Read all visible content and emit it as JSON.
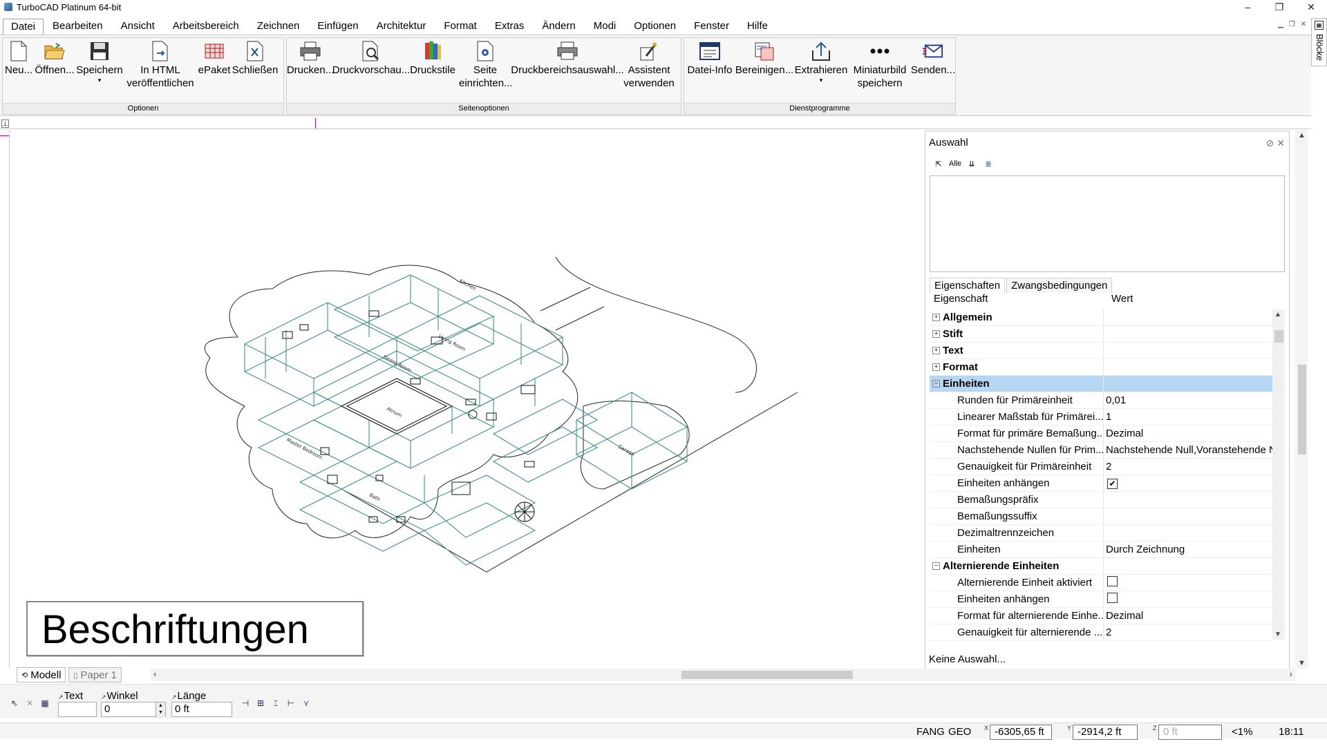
{
  "app": {
    "title": "TurboCAD  Platinum 64-bit",
    "window_controls": [
      "–",
      "❐",
      "✕"
    ]
  },
  "menu": {
    "items": [
      "Datei",
      "Bearbeiten",
      "Ansicht",
      "Arbeitsbereich",
      "Zeichnen",
      "Einfügen",
      "Architektur",
      "Format",
      "Extras",
      "Ändern",
      "Modi",
      "Optionen",
      "Fenster",
      "Hilfe"
    ],
    "active": "Datei"
  },
  "ribbon": {
    "groups": [
      {
        "label": "Optionen",
        "buttons": [
          {
            "label": "Neu...",
            "icon": "new-file-icon"
          },
          {
            "label": "Öffnen...",
            "icon": "open-folder-icon"
          },
          {
            "label": "Speichern",
            "icon": "save-icon",
            "dropdown": true
          },
          {
            "label": "In HTML veröffentlichen",
            "icon": "html-publish-icon"
          },
          {
            "label": "ePaket",
            "icon": "epackage-icon"
          },
          {
            "label": "Schließen",
            "icon": "close-document-icon"
          }
        ]
      },
      {
        "label": "Seitenoptionen",
        "buttons": [
          {
            "label": "Drucken...",
            "icon": "printer-icon"
          },
          {
            "label": "Druckvorschau...",
            "icon": "print-preview-icon"
          },
          {
            "label": "Druckstile",
            "icon": "print-styles-icon"
          },
          {
            "label": "Seite einrichten...",
            "icon": "page-setup-icon"
          },
          {
            "label": "Druckbereichsauswahl...",
            "icon": "print-area-icon"
          },
          {
            "label": "Assistent verwenden",
            "icon": "wizard-icon"
          }
        ]
      },
      {
        "label": "Dienstprogramme",
        "buttons": [
          {
            "label": "Datei-Info",
            "icon": "file-info-icon"
          },
          {
            "label": "Bereinigen...",
            "icon": "cleanup-icon"
          },
          {
            "label": "Extrahieren",
            "icon": "extract-icon",
            "dropdown": true
          },
          {
            "label": "Miniaturbild speichern",
            "icon": "thumbnail-icon"
          },
          {
            "label": "Senden...",
            "icon": "send-mail-icon"
          }
        ]
      }
    ]
  },
  "side_strip": {
    "label": "Blöcke"
  },
  "drawing": {
    "text_box": "Beschriftungen",
    "room_labels": [
      "Living Room",
      "Atrium",
      "Garage",
      "Kitchen",
      "Master Bedroom",
      "Dining Room",
      "Bath"
    ]
  },
  "selector_panel": {
    "title": "Auswahl",
    "tool_icons": [
      "select-tool-icon",
      "Alle",
      "filter-icon",
      "layers-icon"
    ],
    "tabs": [
      "Eigenschaften",
      "Zwangsbedingungen"
    ],
    "active_tab": "Eigenschaften",
    "columns": [
      "Eigenschaft",
      "Wert"
    ],
    "rows": [
      {
        "type": "category",
        "label": "Allgemein",
        "expanded": false,
        "value": ""
      },
      {
        "type": "category",
        "label": "Stift",
        "expanded": false,
        "value": ""
      },
      {
        "type": "category",
        "label": "Text",
        "expanded": false,
        "value": ""
      },
      {
        "type": "category",
        "label": "Format",
        "expanded": false,
        "value": ""
      },
      {
        "type": "category",
        "label": "Einheiten",
        "expanded": true,
        "selected": true,
        "value": ""
      },
      {
        "type": "prop",
        "label": "Runden für Primäreinheit",
        "value": "0,01"
      },
      {
        "type": "prop",
        "label": "Linearer Maßstab für Primärei...",
        "value": "1"
      },
      {
        "type": "prop",
        "label": "Format für primäre Bemaßung...",
        "value": "Dezimal"
      },
      {
        "type": "prop",
        "label": "Nachstehende Nullen für Prim...",
        "value": "Nachstehende Null,Voranstehende N"
      },
      {
        "type": "prop",
        "label": "Genauigkeit für Primäreinheit",
        "value": "2"
      },
      {
        "type": "prop",
        "label": "Einheiten anhängen",
        "value": "",
        "checkbox": true,
        "checked": true
      },
      {
        "type": "prop",
        "label": "Bemaßungspräfix",
        "value": ""
      },
      {
        "type": "prop",
        "label": "Bemaßungssuffix",
        "value": ""
      },
      {
        "type": "prop",
        "label": "Dezimaltrennzeichen",
        "value": ""
      },
      {
        "type": "prop",
        "label": "Einheiten",
        "value": "Durch Zeichnung"
      },
      {
        "type": "category",
        "label": "Alternierende Einheiten",
        "expanded": true,
        "value": ""
      },
      {
        "type": "prop",
        "label": "Alternierende Einheit aktiviert",
        "value": "",
        "checkbox": true,
        "checked": false
      },
      {
        "type": "prop",
        "label": "Einheiten anhängen",
        "value": "",
        "checkbox": true,
        "checked": false
      },
      {
        "type": "prop",
        "label": "Format für alternierende Einhe...",
        "value": "Dezimal"
      },
      {
        "type": "prop",
        "label": "Genauigkeit für alternierende ...",
        "value": "2"
      }
    ],
    "status": "Keine Auswahl..."
  },
  "sheet_tabs": [
    {
      "label": "Modell",
      "active": true
    },
    {
      "label": "Paper 1",
      "active": false
    }
  ],
  "inspector": {
    "text": {
      "label": "Text",
      "value": ""
    },
    "winkel": {
      "label": "Winkel",
      "value": "0"
    },
    "laenge": {
      "label": "Länge",
      "value": "0 ft"
    }
  },
  "statusbar": {
    "fang": "FANG",
    "geo": "GEO",
    "x": "-6305,65 ft",
    "y": "-2914,2 ft",
    "z": "0 ft",
    "zoom": "<1%",
    "time": "18:11"
  }
}
